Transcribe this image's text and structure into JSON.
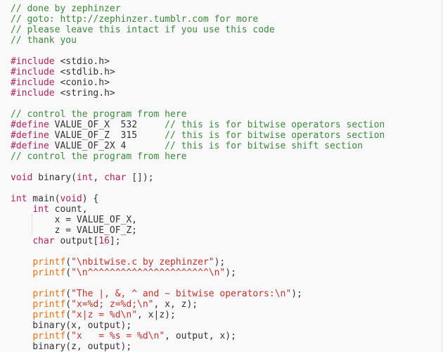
{
  "editor": {
    "language": "c",
    "colors": {
      "background": "#f9f9f9",
      "text": "#333333",
      "comment": "#3a8a3a",
      "keyword": "#b0205c",
      "function": "#e8700f",
      "string": "#c4302b"
    },
    "lines": [
      [
        {
          "t": "comment",
          "v": "// done by zephinzer"
        }
      ],
      [
        {
          "t": "comment",
          "v": "// goto: http://zephinzer.tumblr.com for more"
        }
      ],
      [
        {
          "t": "comment",
          "v": "// please leave this intact if you use this code"
        }
      ],
      [
        {
          "t": "comment",
          "v": "// thank you"
        }
      ],
      [],
      [
        {
          "t": "pre",
          "v": "#include"
        },
        {
          "t": "plain",
          "v": " <stdio.h>"
        }
      ],
      [
        {
          "t": "pre",
          "v": "#include"
        },
        {
          "t": "plain",
          "v": " <stdlib.h>"
        }
      ],
      [
        {
          "t": "pre",
          "v": "#include"
        },
        {
          "t": "plain",
          "v": " <conio.h>"
        }
      ],
      [
        {
          "t": "pre",
          "v": "#include"
        },
        {
          "t": "plain",
          "v": " <string.h>"
        }
      ],
      [],
      [
        {
          "t": "comment",
          "v": "// control the program from here"
        }
      ],
      [
        {
          "t": "pre",
          "v": "#define"
        },
        {
          "t": "plain",
          "v": " VALUE_OF_X  532     "
        },
        {
          "t": "comment",
          "v": "// this is for bitwise operators section"
        }
      ],
      [
        {
          "t": "pre",
          "v": "#define"
        },
        {
          "t": "plain",
          "v": " VALUE_OF_Z  315     "
        },
        {
          "t": "comment",
          "v": "// this is for bitwise operators section"
        }
      ],
      [
        {
          "t": "pre",
          "v": "#define"
        },
        {
          "t": "plain",
          "v": " VALUE_OF_2X 4       "
        },
        {
          "t": "comment",
          "v": "// this is for bitwise shift section"
        }
      ],
      [
        {
          "t": "comment",
          "v": "// control the program from here"
        }
      ],
      [],
      [
        {
          "t": "kw",
          "v": "void"
        },
        {
          "t": "plain",
          "v": " binary("
        },
        {
          "t": "kw",
          "v": "int"
        },
        {
          "t": "plain",
          "v": ", "
        },
        {
          "t": "kw",
          "v": "char"
        },
        {
          "t": "plain",
          "v": " []);"
        }
      ],
      [],
      [
        {
          "t": "kw",
          "v": "int"
        },
        {
          "t": "plain",
          "v": " main("
        },
        {
          "t": "kw",
          "v": "void"
        },
        {
          "t": "plain",
          "v": ") {"
        }
      ],
      [
        {
          "t": "plain",
          "v": "    "
        },
        {
          "t": "kw",
          "v": "int"
        },
        {
          "t": "plain",
          "v": " count,"
        }
      ],
      [
        {
          "t": "plain",
          "v": "        x = VALUE_OF_X,"
        }
      ],
      [
        {
          "t": "plain",
          "v": "        z = VALUE_OF_Z;"
        }
      ],
      [
        {
          "t": "plain",
          "v": "    "
        },
        {
          "t": "kw",
          "v": "char"
        },
        {
          "t": "plain",
          "v": " output["
        },
        {
          "t": "num",
          "v": "16"
        },
        {
          "t": "plain",
          "v": "];"
        }
      ],
      [],
      [
        {
          "t": "plain",
          "v": "    "
        },
        {
          "t": "fn",
          "v": "printf"
        },
        {
          "t": "plain",
          "v": "("
        },
        {
          "t": "str",
          "v": "\"\\nbitwise.c by zephinzer\""
        },
        {
          "t": "plain",
          "v": ");"
        }
      ],
      [
        {
          "t": "plain",
          "v": "    "
        },
        {
          "t": "fn",
          "v": "printf"
        },
        {
          "t": "plain",
          "v": "("
        },
        {
          "t": "str",
          "v": "\"\\n^^^^^^^^^^^^^^^^^^^^^^\\n\""
        },
        {
          "t": "plain",
          "v": ");"
        }
      ],
      [],
      [
        {
          "t": "plain",
          "v": "    "
        },
        {
          "t": "fn",
          "v": "printf"
        },
        {
          "t": "plain",
          "v": "("
        },
        {
          "t": "str",
          "v": "\"The |, &, ^ and ~ bitwise operators:\\n\""
        },
        {
          "t": "plain",
          "v": ");"
        }
      ],
      [
        {
          "t": "plain",
          "v": "    "
        },
        {
          "t": "fn",
          "v": "printf"
        },
        {
          "t": "plain",
          "v": "("
        },
        {
          "t": "str",
          "v": "\"x=%d; z=%d;\\n\""
        },
        {
          "t": "plain",
          "v": ", x, z);"
        }
      ],
      [
        {
          "t": "plain",
          "v": "    "
        },
        {
          "t": "fn",
          "v": "printf"
        },
        {
          "t": "plain",
          "v": "("
        },
        {
          "t": "str",
          "v": "\"x|z = %d\\n\""
        },
        {
          "t": "plain",
          "v": ", x|z);"
        }
      ],
      [
        {
          "t": "plain",
          "v": "    binary(x, output);"
        }
      ],
      [
        {
          "t": "plain",
          "v": "    "
        },
        {
          "t": "fn",
          "v": "printf"
        },
        {
          "t": "plain",
          "v": "("
        },
        {
          "t": "str",
          "v": "\"x   = %s = %d\\n\""
        },
        {
          "t": "plain",
          "v": ", output, x);"
        }
      ],
      [
        {
          "t": "plain",
          "v": "    binary(z, output);"
        }
      ]
    ]
  }
}
